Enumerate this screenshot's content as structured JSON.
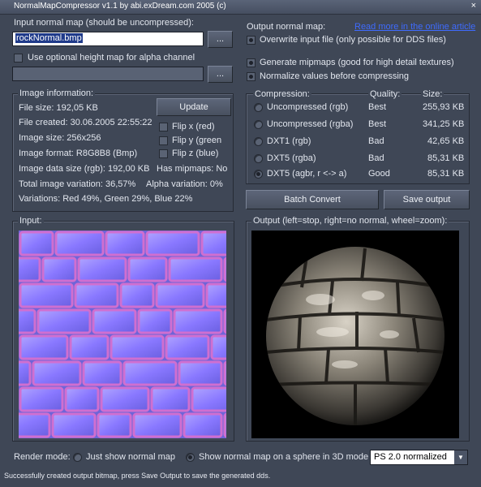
{
  "window": {
    "title": "NormalMapCompressor v1.1 by abi.exDream.com 2005 (c)",
    "close": "×"
  },
  "input": {
    "label": "Input normal map (should be uncompressed):",
    "value": "rockNormal.bmp",
    "browse": "...",
    "height_label": "Use optional height map for alpha channel",
    "height_browse": "..."
  },
  "output": {
    "label": "Output normal map:",
    "read_more": "Read more in the online article",
    "overwrite": "Overwrite input file (only possible for DDS files)",
    "mipmaps": "Generate mipmaps (good for high detail textures)",
    "normalize": "Normalize values before compressing"
  },
  "image_info": {
    "title": "Image information:",
    "update": "Update",
    "file_size": "File size: 192,05 KB",
    "file_created": "File created: 30.06.2005 22:55:22",
    "image_size": "Image size: 256x256",
    "image_format": "Image format: R8G8B8 (Bmp)",
    "data_size": "Image data size (rgb): 192,00 KB",
    "has_mipmaps": "Has mipmaps: No",
    "total_variation": "Total image variation: 36,57%",
    "alpha_variation": "Alpha variation: 0%",
    "variations": "Variations: Red 49%, Green 29%, Blue 22%",
    "flip_x": "Flip x (red)",
    "flip_y": "Flip  y (green",
    "flip_z": "Flip z (blue)"
  },
  "compression": {
    "headers": {
      "name": "Compression:",
      "quality": "Quality:",
      "size": "Size:"
    },
    "rows": [
      {
        "name": "Uncompressed (rgb)",
        "quality": "Best",
        "size": "255,93 KB",
        "selected": false
      },
      {
        "name": "Uncompressed (rgba)",
        "quality": "Best",
        "size": "341,25 KB",
        "selected": false
      },
      {
        "name": "DXT1 (rgb)",
        "quality": "Bad",
        "size": "42,65 KB",
        "selected": false
      },
      {
        "name": "DXT5 (rgba)",
        "quality": "Bad",
        "size": "85,31 KB",
        "selected": false
      },
      {
        "name": "DXT5 (agbr, r <-> a)",
        "quality": "Good",
        "size": "85,31 KB",
        "selected": true
      }
    ]
  },
  "actions": {
    "batch": "Batch Convert",
    "save": "Save output"
  },
  "panels": {
    "input_title": "Input:",
    "output_title": "Output (left=stop, right=no normal, wheel=zoom):"
  },
  "render": {
    "label": "Render mode:",
    "just_normal": "Just show normal map",
    "sphere": "Show normal map on a sphere in 3D mode",
    "shader": "PS 2.0 normalized",
    "selected": "sphere"
  },
  "status": "Successfully created output bitmap, press Save Output to save the generated dds.",
  "colors": {
    "background": "#3f4756",
    "link": "#3f6bff",
    "normal_base": "#8a78ff"
  }
}
